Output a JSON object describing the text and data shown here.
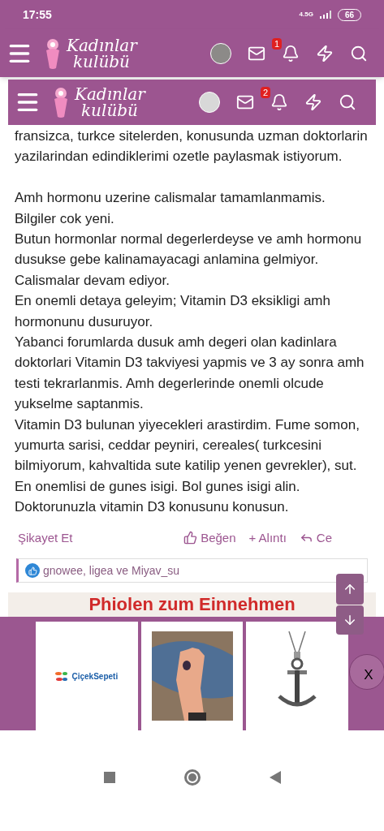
{
  "status_bar": {
    "time": "17:55",
    "network": "4.5G",
    "battery": "66"
  },
  "app_header": {
    "logo_line1": "Kadınlar",
    "logo_line2": "kulübü",
    "notification_count": "1"
  },
  "site_header": {
    "logo_line1": "Kadınlar",
    "logo_line2": "kulübü",
    "notification_count": "2"
  },
  "post_paragraphs": [
    [
      "fransizca, turkce sitelerden, konusunda uzman doktorlarin yazilarindan edindiklerimi ozetle paylasmak istiyorum."
    ],
    [
      "Amh hormonu uzerine calismalar tamamlanmamis.",
      "Bilgiler cok yeni.",
      "Butun hormonlar normal degerlerdeyse ve amh hormonu dusukse gebe kalinamayacagi anlamina gelmiyor. Calismalar devam ediyor.",
      "En onemli detaya geleyim; Vitamin D3 eksikligi amh hormonunu dusuruyor.",
      "Yabanci forumlarda dusuk amh degeri olan kadinlara doktorlari Vitamin D3 takviyesi yapmis ve 3 ay sonra amh testi tekrarlanmis. Amh degerlerinde onemli olcude yukselme saptanmis.",
      "Vitamin D3 bulunan yiyecekleri arastirdim. Fume somon, yumurta sarisi, ceddar peyniri, cereales( turkcesini bilmiyorum, kahvaltida sute katilip yenen gevrekler), sut.",
      "En onemlisi de gunes isigi. Bol gunes isigi alin.",
      "Doktorunuzla vitamin D3 konusunu konusun."
    ]
  ],
  "post_actions": {
    "report": "Şikayet Et",
    "like": "Beğen",
    "quote": "+ Alıntı",
    "reply": "Ce"
  },
  "likes": "gnowee, ligea ve Miyav_su",
  "ad_banner": {
    "text": "Phiolen zum Einnehmen",
    "close": "X"
  },
  "ad_cards": [
    {
      "kind": "logo",
      "text": "ÇiçekSepeti"
    },
    {
      "kind": "picture"
    },
    {
      "kind": "picture"
    }
  ]
}
